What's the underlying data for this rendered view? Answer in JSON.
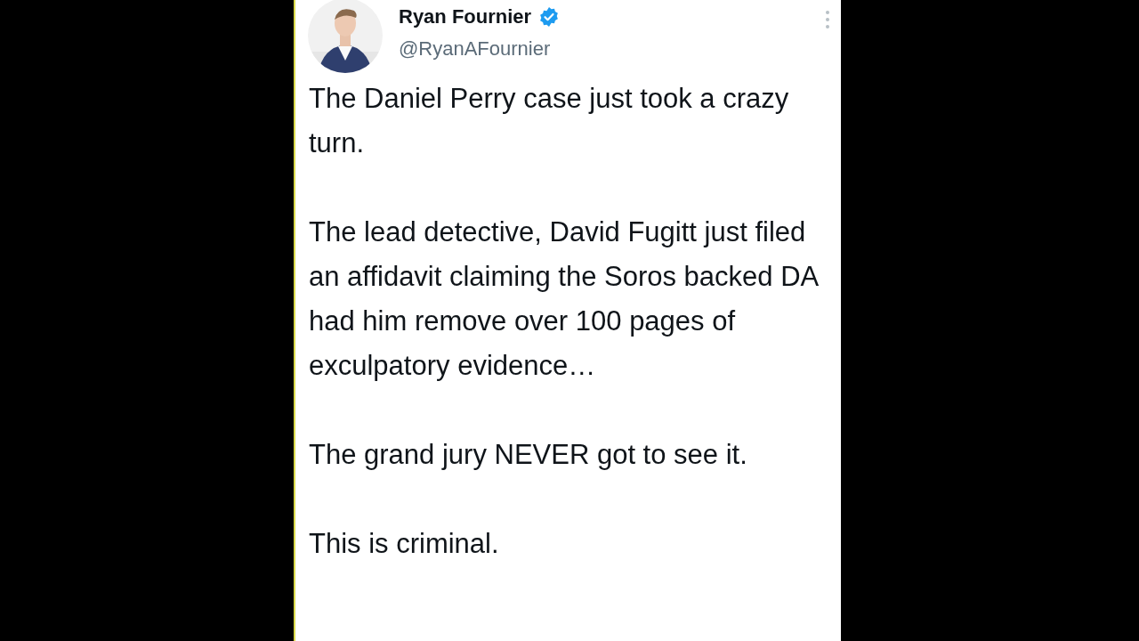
{
  "post": {
    "author": {
      "name": "Ryan Fournier",
      "verified": true,
      "handle": "@RyanAFournier"
    },
    "paragraphs": [
      "The Daniel Perry case just took a crazy turn.",
      "The lead detective, David Fugitt just filed an affidavit claiming the Soros backed DA had him remove over 100 pages of exculpatory evidence…",
      "The grand jury NEVER got to see it.",
      "This is criminal."
    ]
  }
}
